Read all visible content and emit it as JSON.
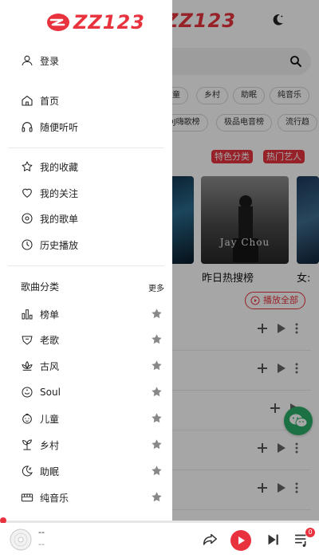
{
  "app": {
    "logo_text": "ZZ123"
  },
  "background": {
    "chips_row1": [
      "儿童",
      "乡村",
      "助眠",
      "纯音乐"
    ],
    "chips_row2": [
      "DJ嗨歌榜",
      "极品电音榜",
      "流行趋"
    ],
    "tags": [
      "特色分类",
      "热门艺人"
    ],
    "cards": [
      {
        "title": "",
        "cover_text": ""
      },
      {
        "title": "昨日热搜榜",
        "cover_text": "Jay Chou"
      },
      {
        "title": "女:",
        "cover_text": ""
      }
    ],
    "play_all_label": "播放全部",
    "row_count": 5
  },
  "drawer": {
    "login": {
      "label": "登录",
      "icon": "user-icon"
    },
    "nav": [
      {
        "label": "首页",
        "icon": "home-icon"
      },
      {
        "label": "随便听听",
        "icon": "headphones-icon"
      }
    ],
    "personal": [
      {
        "label": "我的收藏",
        "icon": "star-outline-icon"
      },
      {
        "label": "我的关注",
        "icon": "heart-icon"
      },
      {
        "label": "我的歌单",
        "icon": "disc-icon"
      },
      {
        "label": "历史播放",
        "icon": "clock-icon"
      }
    ],
    "categories": {
      "title": "歌曲分类",
      "more": "更多",
      "items": [
        {
          "label": "榜单",
          "icon": "bar-chart-icon"
        },
        {
          "label": "老歌",
          "icon": "shield-icon"
        },
        {
          "label": "古风",
          "icon": "lotus-icon"
        },
        {
          "label": "Soul",
          "icon": "soul-icon"
        },
        {
          "label": "儿童",
          "icon": "child-icon"
        },
        {
          "label": "乡村",
          "icon": "sprout-icon"
        },
        {
          "label": "助眠",
          "icon": "moon-icon"
        },
        {
          "label": "纯音乐",
          "icon": "piano-icon"
        }
      ]
    }
  },
  "player": {
    "title": "--",
    "artist": "--",
    "queue_count": "0",
    "progress": 0.0
  },
  "colors": {
    "brand": "#e8333e",
    "wechat": "#2aae67"
  }
}
